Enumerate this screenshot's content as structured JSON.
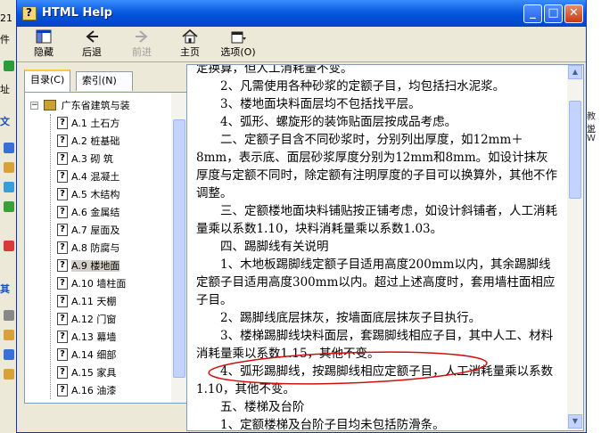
{
  "window": {
    "title": "HTML Help",
    "minimize_label": "_",
    "maximize_label": "□",
    "close_label": "✕"
  },
  "background": {
    "left_fragments": [
      "21",
      "件",
      "址",
      "文",
      "其"
    ],
    "right_fragments": [
      "教工",
      "说",
      "W"
    ]
  },
  "toolbar": {
    "hide_label": "隐藏",
    "back_label": "后退",
    "forward_label": "前进",
    "home_label": "主页",
    "options_label": "选项(O)"
  },
  "tabs": {
    "contents_label": "目录(C)",
    "index_label": "索引(N)"
  },
  "tree": {
    "root_label": "广东省建筑与装",
    "items": [
      {
        "label": "A.1  土石方"
      },
      {
        "label": "A.2  桩基础"
      },
      {
        "label": "A.3  砌  筑"
      },
      {
        "label": "A.4  混凝土"
      },
      {
        "label": "A.5  木结构"
      },
      {
        "label": "A.6  金属结"
      },
      {
        "label": "A.7  屋面及"
      },
      {
        "label": "A.8  防腐与"
      },
      {
        "label": "A.9  楼地面"
      },
      {
        "label": "A.10  墙柱面"
      },
      {
        "label": "A.11  天棚"
      },
      {
        "label": "A.12  门窗"
      },
      {
        "label": "A.13  幕墙"
      },
      {
        "label": "A.14  细部"
      },
      {
        "label": "A.15  家具"
      },
      {
        "label": "A.16  油漆"
      }
    ]
  },
  "content": {
    "lines": [
      "定换算，但人工消耗量不变。",
      "　　2、凡需使用各种砂浆的定额子目，均包括扫水泥浆。",
      "　　3、楼地面块料面层均不包括找平层。",
      "　　4、弧形、螺旋形的装饰贴面层按成品考虑。",
      "　　二、定额子目含不同砂浆时，分别列出厚度，如12mm＋8mm，表示底、面层砂浆厚度分别为12mm和8mm。如设计抹灰厚度与定额不同时，除定额有注明厚度的子目可以换算外，其他不作调整。",
      "　　三、定额楼地面块料铺贴按正铺考虑，如设计斜铺者，人工消耗量乘以系数1.10，块料消耗量乘以系数1.03。",
      "　　四、踢脚线有关说明",
      "　　1、木地板踢脚线定额子目适用高度200mm以内，其余踢脚线定额子目适用高度300mm以内。超过上述高度时，套用墙柱面相应子目。",
      "　　2、踢脚线底层抹灰，按墙面底层抹灰子目执行。",
      "　　3、楼梯踢脚线块料面层，套踢脚线相应子目，其中人工、材料消耗量乘以系数1.15，其他不变。",
      "　　4、弧形踢脚线，按踢脚线相应定额子目，人工消耗量乘以系数1.10，其他不变。",
      "　　五、楼梯及台阶",
      "　　1、定额楼梯及台阶子目均未包括防滑条。"
    ]
  }
}
